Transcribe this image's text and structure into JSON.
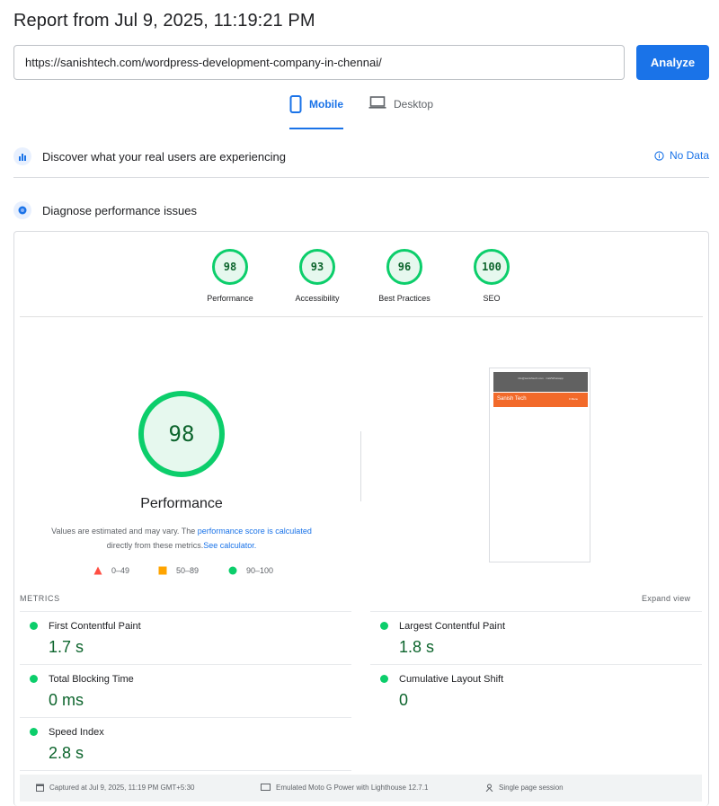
{
  "header": {
    "title": "Report from Jul 9, 2025, 11:19:21 PM"
  },
  "search": {
    "url_value": "https://sanishtech.com/wordpress-development-company-in-chennai/"
  },
  "analyze_label": "Analyze",
  "tabs": [
    {
      "label": "Mobile",
      "selected": true
    },
    {
      "label": "Desktop",
      "selected": false
    }
  ],
  "crux": {
    "heading": "Discover what your real users are experiencing",
    "no_data": "No Data"
  },
  "diagnose": {
    "heading": "Diagnose performance issues"
  },
  "categories": [
    {
      "label": "Performance",
      "score": "98"
    },
    {
      "label": "Accessibility",
      "score": "93"
    },
    {
      "label": "Best Practices",
      "score": "96"
    },
    {
      "label": "SEO",
      "score": "100"
    }
  ],
  "performance": {
    "score": "98",
    "title": "Performance",
    "desc_1": "Values are estimated and may vary. The ",
    "desc_link_1": "performance score is calculated",
    "desc_2": " directly from these metrics.",
    "desc_link_2": "See calculator."
  },
  "legend": {
    "fail": "0–49",
    "average": "50–89",
    "pass": "90–100"
  },
  "screenshot": {
    "top_text": "info@sanishtech.com  ·  Call/Whatsapp",
    "brand": "Sanish Tech",
    "menu": "≡ Menu"
  },
  "metrics": {
    "label": "METRICS",
    "expand": "Expand view",
    "items": [
      {
        "name": "First Contentful Paint",
        "value": "1.7 s"
      },
      {
        "name": "Largest Contentful Paint",
        "value": "1.8 s"
      },
      {
        "name": "Total Blocking Time",
        "value": "0 ms"
      },
      {
        "name": "Cumulative Layout Shift",
        "value": "0"
      },
      {
        "name": "Speed Index",
        "value": "2.8 s"
      }
    ]
  },
  "footer": {
    "captured": "Captured at Jul 9, 2025, 11:19 PM GMT+5:30",
    "device": "Emulated Moto G Power with Lighthouse 12.7.1",
    "session": "Single page session"
  },
  "colors": {
    "pass": "#0cce6b",
    "average": "#ffa400",
    "fail": "#ff4e42",
    "accent": "#1a73e8"
  }
}
